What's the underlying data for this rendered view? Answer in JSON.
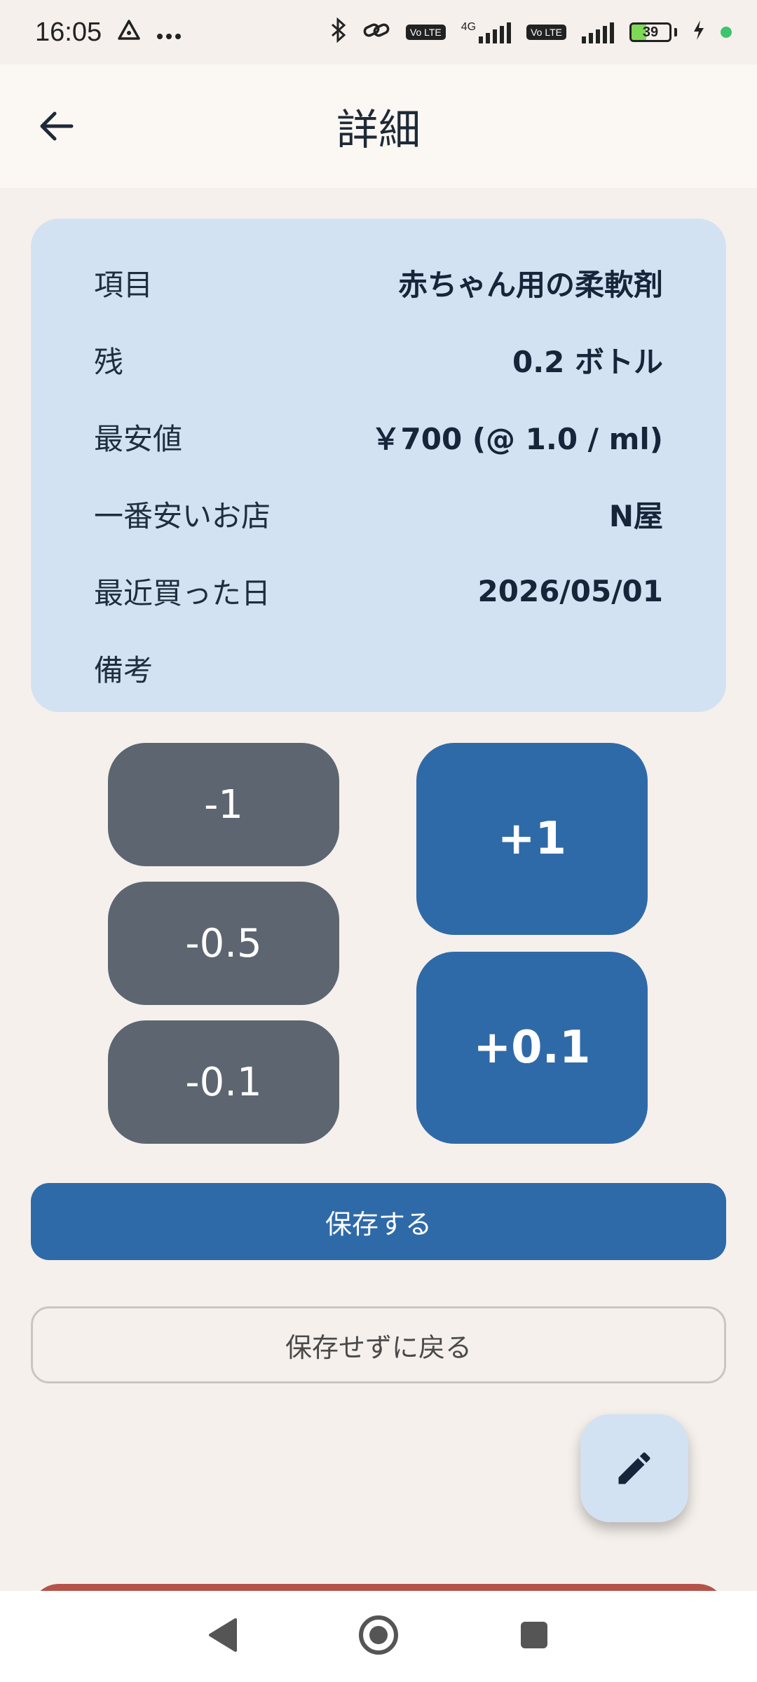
{
  "status_bar": {
    "time": "16:05",
    "left_icons": [
      "triangle-alert-icon",
      "more-dots-icon"
    ],
    "net1_badge": "Vo LTE",
    "net1_type": "4G",
    "net2_badge": "Vo LTE",
    "battery_level": "39",
    "battery_color": "#7ed957",
    "charging": true
  },
  "app_bar": {
    "title": "詳細",
    "back_icon": "arrow-left-icon"
  },
  "details": {
    "rows": [
      {
        "label": "項目",
        "value": "赤ちゃん用の柔軟剤"
      },
      {
        "label": "残",
        "value": "0.2 ボトル"
      },
      {
        "label": "最安値",
        "value": "￥700 (@ 1.0 / ml)"
      },
      {
        "label": "一番安いお店",
        "value": "N屋"
      },
      {
        "label": "最近買った日",
        "value": "2026/05/01"
      },
      {
        "label": "備考",
        "value": ""
      }
    ]
  },
  "adjust_buttons": {
    "minus_1": "-1",
    "minus_05": "-0.5",
    "minus_01": "-0.1",
    "plus_1": "+1",
    "plus_01": "+0.1"
  },
  "actions": {
    "save_label": "保存する",
    "discard_label": "保存せずに戻る",
    "fab_icon": "pencil-icon"
  },
  "colors": {
    "accent": "#2f6aa8",
    "card": "#d3e2f2",
    "neutral_button": "#5d6570",
    "danger": "#b5534a",
    "background": "#f5f0eb"
  }
}
